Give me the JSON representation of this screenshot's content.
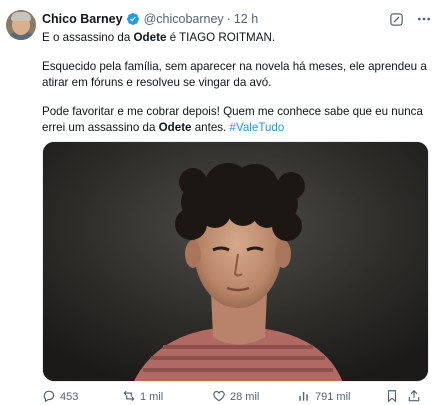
{
  "author": {
    "name": "Chico Barney",
    "handle": "@chicobarney",
    "separator": "·",
    "time": "12 h",
    "verified_color": "#1d9bf0"
  },
  "tweet": {
    "line1": {
      "before": "E o assassino da ",
      "bold": "Odete",
      "after": " é TIAGO ROITMAN."
    },
    "para2": "Esquecido pela família, sem aparecer na novela há meses, ele aprendeu a atirar em fóruns e resolveu se vingar da avó.",
    "para3": {
      "before": "Pode favoritar e me cobrar depois! Quem me conhece sabe que eu nunca errei um assassino da ",
      "bold": "Odete",
      "after": " antes. ",
      "hashtag": "#ValeTudo"
    }
  },
  "media": {
    "icon": "photo-young-man-curly-hair"
  },
  "metrics": {
    "replies": "453",
    "retweets": "1 mil",
    "likes": "28 mil",
    "views": "791 mil"
  },
  "icons": {
    "grok": "grok-icon",
    "more": "more-icon",
    "reply": "reply-icon",
    "retweet": "retweet-icon",
    "like": "heart-icon",
    "views": "views-icon",
    "bookmark": "bookmark-icon",
    "share": "share-icon"
  },
  "colors": {
    "text": "#0f1419",
    "muted": "#536471",
    "link": "#1d9bf0"
  }
}
